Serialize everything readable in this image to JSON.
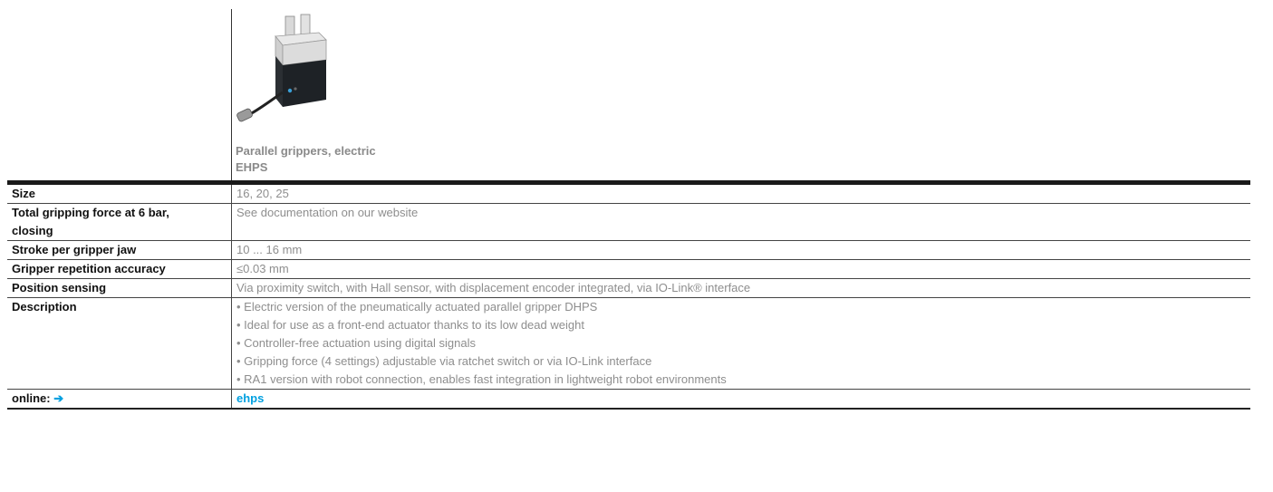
{
  "product": {
    "name": "Parallel grippers, electric",
    "code": "EHPS",
    "image_icon": "gripper-product-image"
  },
  "rows": {
    "size": {
      "label": "Size",
      "value": "16, 20, 25"
    },
    "gripping_force": {
      "label_line1": "Total gripping force at 6 bar,",
      "label_line2": "closing",
      "value": "See documentation on our website"
    },
    "stroke": {
      "label": "Stroke per gripper jaw",
      "value": "10 ... 16 mm"
    },
    "accuracy": {
      "label": "Gripper repetition accuracy",
      "value": "≤0.03 mm"
    },
    "position_sensing": {
      "label": "Position sensing",
      "value": "Via proximity switch, with Hall sensor, with displacement encoder integrated, via IO-Link® interface"
    },
    "description": {
      "label": "Description",
      "items": [
        "• Electric version of the pneumatically actuated parallel gripper DHPS",
        "• Ideal for use as a front-end actuator thanks to its low dead weight",
        "• Controller-free actuation using digital signals",
        "• Gripping force (4 settings) adjustable via ratchet switch or via IO-Link interface",
        "• RA1 version with robot connection, enables fast integration in lightweight robot environments"
      ]
    },
    "online": {
      "label": "online:",
      "arrow": "➔",
      "link": "ehps"
    }
  },
  "colors": {
    "accent": "#00a0e0",
    "value_text": "#8e8e8e",
    "label_text": "#111111"
  }
}
